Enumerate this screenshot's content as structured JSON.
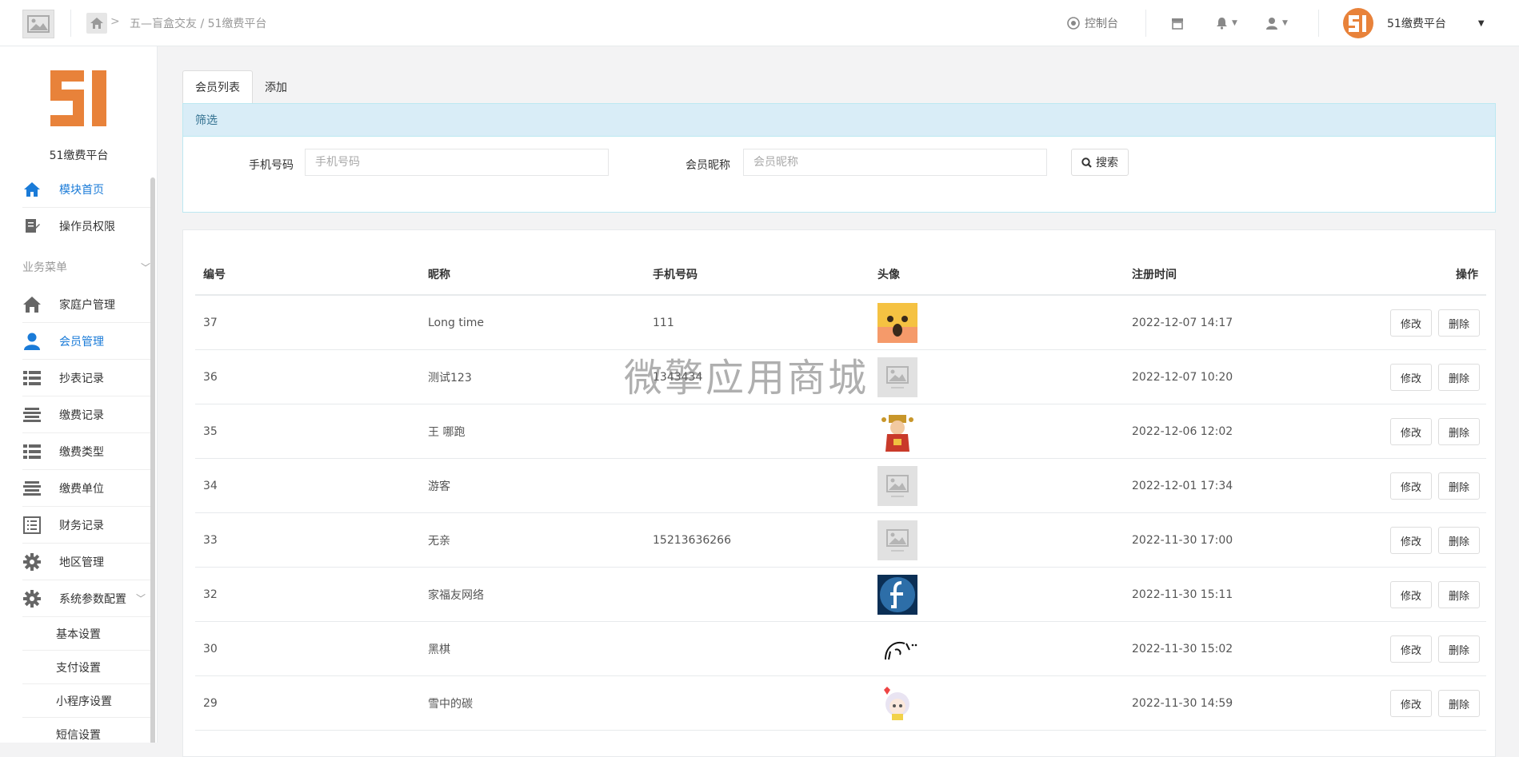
{
  "topbar": {
    "breadcrumb": "五—盲盒交友 / 51缴费平台",
    "console_label": "控制台",
    "user_name": "51缴费平台"
  },
  "sidebar": {
    "brand_name": "51缴费平台",
    "top_items": [
      {
        "label": "模块首页",
        "icon": "home-icon",
        "active": true
      },
      {
        "label": "操作员权限",
        "icon": "edit-doc-icon",
        "active": false
      }
    ],
    "group_label": "业务菜单",
    "items": [
      {
        "label": "家庭户管理",
        "icon": "house-icon"
      },
      {
        "label": "会员管理",
        "icon": "user-icon"
      },
      {
        "label": "抄表记录",
        "icon": "list-icon"
      },
      {
        "label": "缴费记录",
        "icon": "align-icon"
      },
      {
        "label": "缴费类型",
        "icon": "list-icon"
      },
      {
        "label": "缴费单位",
        "icon": "align-icon"
      },
      {
        "label": "财务记录",
        "icon": "ledger-icon"
      },
      {
        "label": "地区管理",
        "icon": "gear-icon"
      },
      {
        "label": "系统参数配置",
        "icon": "gear-icon"
      }
    ],
    "sub_items": [
      "基本设置",
      "支付设置",
      "小程序设置",
      "短信设置"
    ]
  },
  "tabs": [
    "会员列表",
    "添加"
  ],
  "filter": {
    "title": "筛选",
    "phone_label": "手机号码",
    "phone_placeholder": "手机号码",
    "nick_label": "会员昵称",
    "nick_placeholder": "会员昵称",
    "search_label": "搜索"
  },
  "table": {
    "headers": {
      "id": "编号",
      "nick": "昵称",
      "phone": "手机号码",
      "avatar": "头像",
      "reg": "注册时间",
      "ops": "操作"
    },
    "edit_label": "修改",
    "delete_label": "删除",
    "rows": [
      {
        "id": "37",
        "nick": "Long time",
        "phone": "111",
        "avatar": "emoji-face",
        "reg": "2022-12-07 14:17"
      },
      {
        "id": "36",
        "nick": "测试123",
        "phone": "1343434",
        "avatar": "placeholder",
        "reg": "2022-12-07 10:20"
      },
      {
        "id": "35",
        "nick": "王 哪跑",
        "phone": "",
        "avatar": "god-of-wealth",
        "reg": "2022-12-06 12:02"
      },
      {
        "id": "34",
        "nick": "游客",
        "phone": "",
        "avatar": "placeholder",
        "reg": "2022-12-01 17:34"
      },
      {
        "id": "33",
        "nick": "无亲",
        "phone": "15213636266",
        "avatar": "placeholder",
        "reg": "2022-11-30 17:00"
      },
      {
        "id": "32",
        "nick": "家福友网络",
        "phone": "",
        "avatar": "f-logo",
        "reg": "2022-11-30 15:11"
      },
      {
        "id": "30",
        "nick": "黑棋",
        "phone": "",
        "avatar": "sketch",
        "reg": "2022-11-30 15:02"
      },
      {
        "id": "29",
        "nick": "雪中的碳",
        "phone": "",
        "avatar": "anime-girl",
        "reg": "2022-11-30 14:59"
      }
    ]
  },
  "watermark": "微擎应用商城",
  "colors": {
    "accent": "#1a7bd8",
    "brand_orange": "#e8823a",
    "filter_header": "#d9edf7"
  }
}
